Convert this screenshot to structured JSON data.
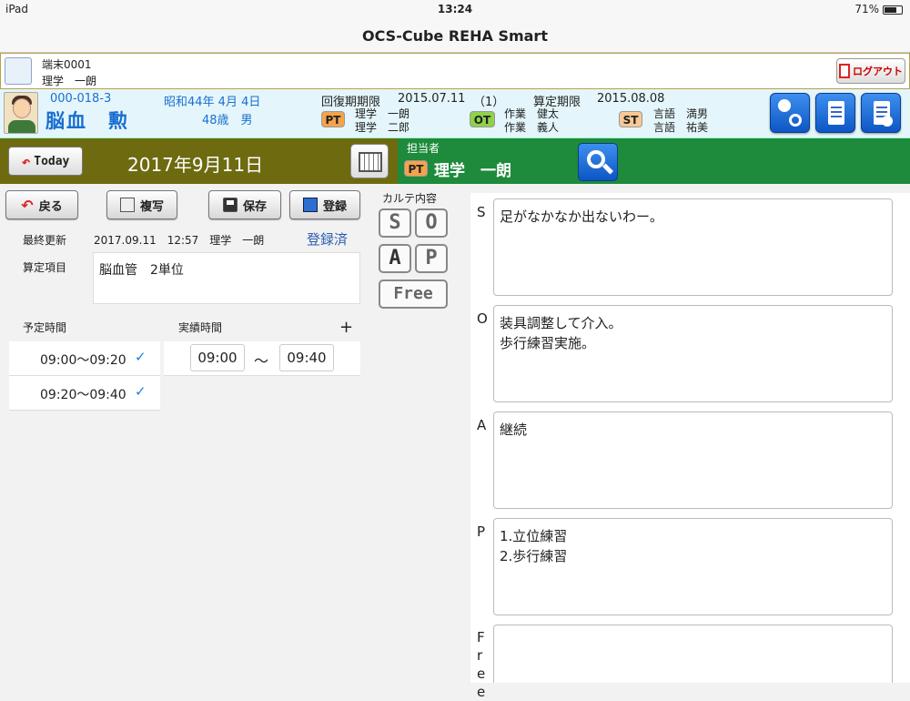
{
  "status": {
    "left": "iPad",
    "time": "13:24",
    "battery": "71%",
    "battery_level": 0.71
  },
  "nav": {
    "title": "OCS-Cube REHA Smart"
  },
  "terminal": {
    "id": "端末0001",
    "user": "理学　一朗",
    "logout": "ログアウト"
  },
  "patient": {
    "id": "000-018-3",
    "name": "脳血　勲",
    "birth": "昭和44年 4月 4日",
    "age_sex": "48歳　男",
    "recovery_label": "回復期期限",
    "recovery_date": "2015.07.11",
    "recovery_count": "（1）",
    "calc_label": "算定期限",
    "calc_date": "2015.08.08",
    "pt": {
      "badge": "PT",
      "line1": "理学　一朗",
      "line2": "理学　二郎"
    },
    "ot": {
      "badge": "OT",
      "line1": "作業　健太",
      "line2": "作業　義人"
    },
    "st": {
      "badge": "ST",
      "line1": "言語　満男",
      "line2": "言語　祐美"
    }
  },
  "datebar": {
    "today": "Today",
    "date": "2017年9月11日"
  },
  "staff": {
    "label": "担当者",
    "badge": "PT",
    "name": "理学　一朗"
  },
  "actions": {
    "back": "戻る",
    "copy": "複写",
    "save": "保存",
    "register": "登録"
  },
  "record": {
    "updated_label": "最終更新",
    "updated_value": "2017.09.11　12:57　理学　一朗",
    "status": "登録済",
    "calc_item_label": "算定項目",
    "calc_item_value": "脳血管　2単位",
    "planned_label": "予定時間",
    "actual_label": "実績時間",
    "add": "+",
    "planned": [
      "09:00〜09:20",
      "09:20〜09:40"
    ],
    "actual_start": "09:00",
    "actual_sep": "〜",
    "actual_end": "09:40"
  },
  "karte": {
    "label": "カルテ内容",
    "s": "S",
    "o": "O",
    "a": "A",
    "p": "P",
    "free": "Free"
  },
  "soap": {
    "s_label": "S",
    "s_text": "足がなかなか出ないわー。",
    "o_label": "O",
    "o_text": "装具調整して介入。\n歩行練習実施。",
    "a_label": "A",
    "a_text": "継続",
    "p_label": "P",
    "p_text": "1.立位練習\n2.歩行練習",
    "free_label": "Free",
    "free_text": ""
  }
}
